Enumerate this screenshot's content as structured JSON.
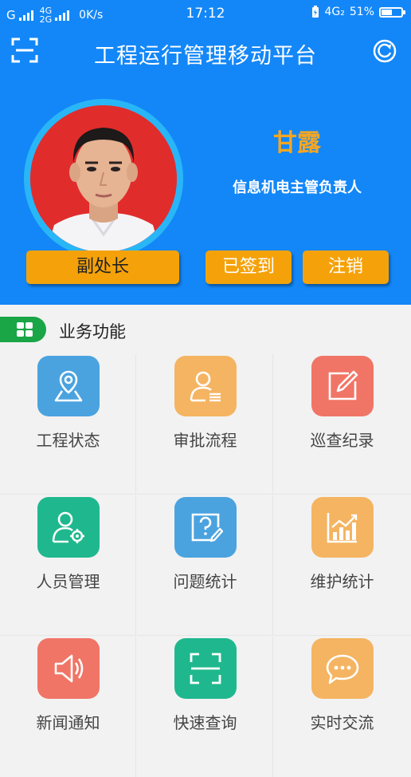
{
  "status_bar": {
    "carrier_1": "G",
    "net_4g": "4G",
    "net_2g": "2G",
    "speed": "0K/s",
    "time": "17:12",
    "right_net": "4G₂",
    "battery": "51%"
  },
  "header": {
    "title": "工程运行管理移动平台"
  },
  "profile": {
    "name": "甘露",
    "role": "信息机电主管负责人",
    "rank": "副处长",
    "signed_label": "已签到",
    "logout_label": "注销"
  },
  "section": {
    "title": "业务功能"
  },
  "functions": [
    {
      "label": "工程状态",
      "icon": "map-location-icon",
      "color": "#4aa3df"
    },
    {
      "label": "审批流程",
      "icon": "user-approval-icon",
      "color": "#f5b461"
    },
    {
      "label": "巡查纪录",
      "icon": "edit-record-icon",
      "color": "#f07566"
    },
    {
      "label": "人员管理",
      "icon": "user-settings-icon",
      "color": "#1fb88e"
    },
    {
      "label": "问题统计",
      "icon": "question-edit-icon",
      "color": "#4aa3df"
    },
    {
      "label": "维护统计",
      "icon": "bar-chart-icon",
      "color": "#f5b461"
    },
    {
      "label": "新闻通知",
      "icon": "speaker-icon",
      "color": "#f07566"
    },
    {
      "label": "快速查询",
      "icon": "scan-frame-icon",
      "color": "#1fb88e"
    },
    {
      "label": "实时交流",
      "icon": "chat-bubble-icon",
      "color": "#f5b461"
    }
  ],
  "colors": {
    "header_bg": "#1387f7",
    "accent_orange": "#f5a20a",
    "name_color": "#f5a623",
    "section_pill": "#1aa547"
  }
}
